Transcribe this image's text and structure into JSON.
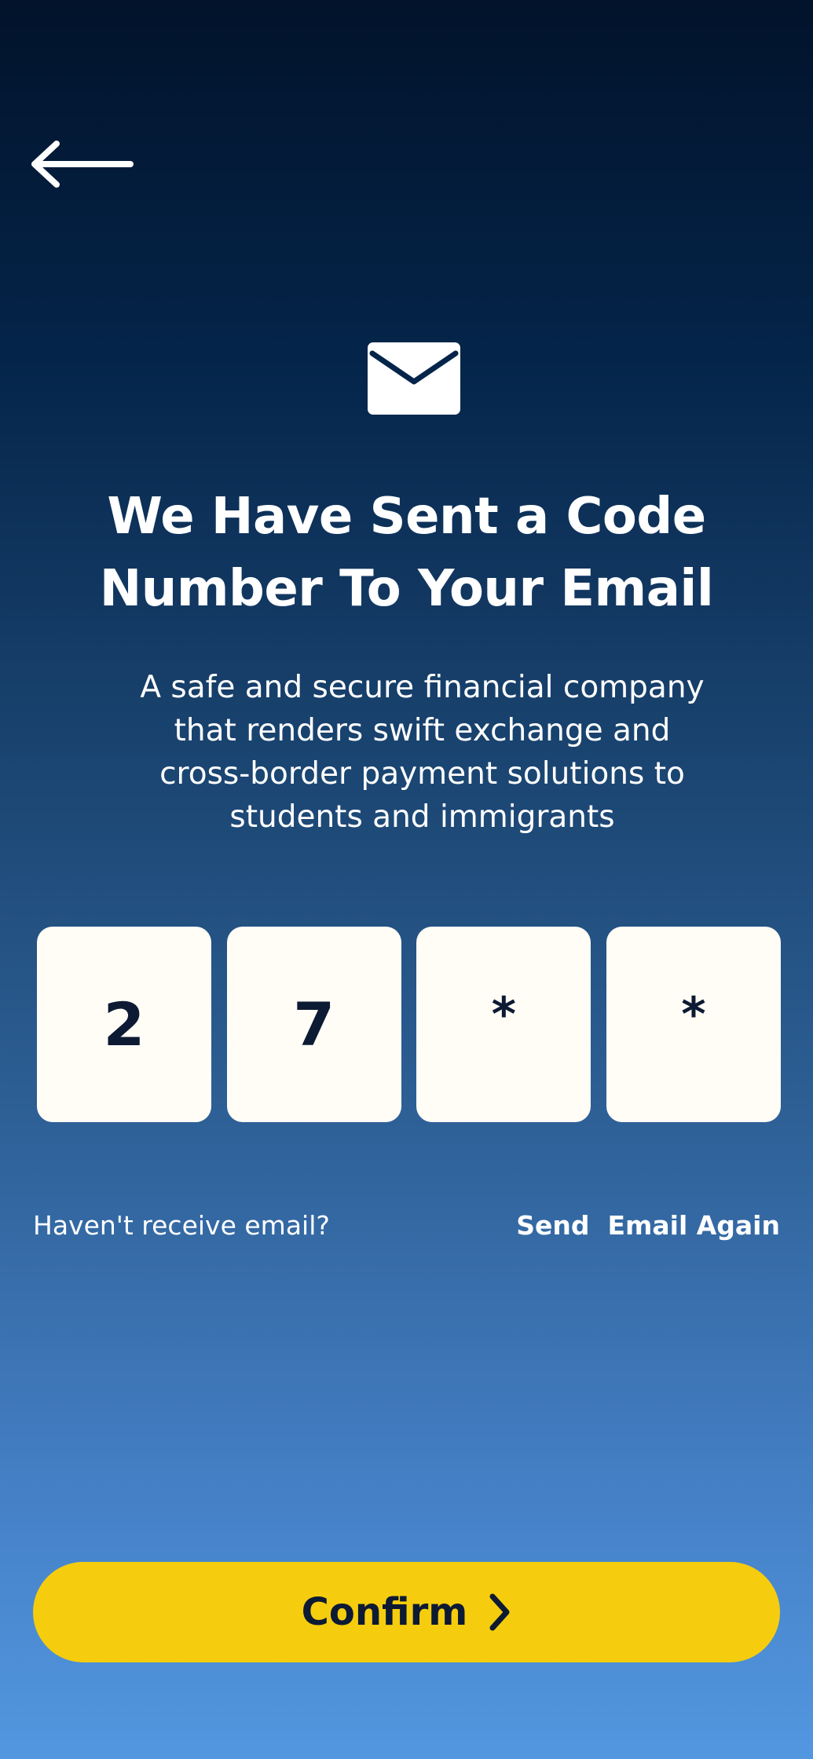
{
  "header": {
    "back_icon": "arrow-left-icon"
  },
  "hero": {
    "icon": "mail-icon",
    "title_line1": "We Have Sent a Code",
    "title_line2": "Number To Your Email",
    "description_line1": "A safe and secure financial company",
    "description_line2": "that renders swift exchange and",
    "description_line3": "cross-border payment solutions to",
    "description_line4": "students and immigrants"
  },
  "code": {
    "digits": [
      "2",
      "7",
      "*",
      "*"
    ]
  },
  "resend": {
    "question": "Haven't receive email?",
    "link": "Send  Email Again"
  },
  "confirm": {
    "label": "Confirm",
    "icon": "chevron-right-icon"
  },
  "colors": {
    "background_top": "#02132b",
    "background_bottom": "#5297e0",
    "accent": "#f5cd0e",
    "code_box": "#fffdf6",
    "dark_text": "#0d1a33"
  }
}
